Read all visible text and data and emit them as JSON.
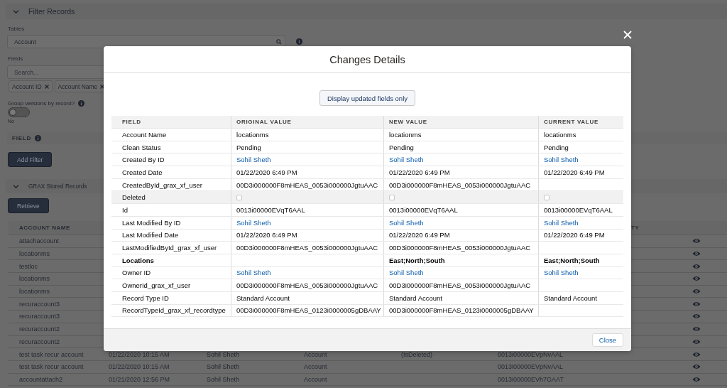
{
  "background": {
    "filter_section": {
      "title": "Filter Records",
      "expanded": true
    },
    "tables": {
      "label": "Tables",
      "value": "Account"
    },
    "fields": {
      "label": "Fields",
      "placeholder": "Search...",
      "pills": [
        "Account ID",
        "Account Name"
      ]
    },
    "group_versions": {
      "label": "Group versions by record?",
      "on": false,
      "state_label": "No"
    },
    "filter_header": "FIELD",
    "add_filter_button": "Add Filter",
    "records_section": {
      "title": "GRAX Stored Records",
      "expanded": true
    },
    "retrieve_button": "Retrieve",
    "records_table": {
      "columns": {
        "account_name": "ACCOUNT NAME",
        "column_7": "TY"
      },
      "rows": [
        {
          "account_name": "attachaccount"
        },
        {
          "account_name": "locationms"
        },
        {
          "account_name": "testloc"
        },
        {
          "account_name": "locationms"
        },
        {
          "account_name": "locationms"
        },
        {
          "account_name": "recuraccount3"
        },
        {
          "account_name": "recuraccount3"
        },
        {
          "account_name": "recuraccount2"
        },
        {
          "account_name": "recuraccount2"
        },
        {
          "account_name": "test task recur account",
          "column_2": "01/22/2020 10:15 AM",
          "column_3": "Sohil Sheth",
          "column_4": "Account",
          "column_5": "(IsDeleted)",
          "column_6": "0013i00000EVpNvAAL"
        },
        {
          "account_name": "test task recur account",
          "column_2": "01/22/2020 10:15 AM",
          "column_3": "Sohil Sheth",
          "column_4": "Account",
          "column_6": "0013i00000EVpNvAAL"
        },
        {
          "account_name": "accountattach2",
          "column_2": "01/21/2020 12:56 PM",
          "column_3": "Sohil Sheth",
          "column_4": "Account",
          "column_6": "0013i00000EVh7GAAT"
        }
      ]
    }
  },
  "modal": {
    "title": "Changes Details",
    "filter_button": "Display updated fields only",
    "columns": [
      "FIELD",
      "ORIGINAL VALUE",
      "NEW VALUE",
      "CURRENT VALUE"
    ],
    "rows": [
      {
        "field": "Account Name",
        "kind": "text",
        "highlighted": false,
        "original": "locationms",
        "new": "locationms",
        "current": "locationms"
      },
      {
        "field": "Clean Status",
        "kind": "text",
        "highlighted": false,
        "original": "Pending",
        "new": "Pending",
        "current": "Pending"
      },
      {
        "field": "Created By ID",
        "kind": "link",
        "highlighted": false,
        "original": "Sohil Sheth",
        "new": "Sohil Sheth",
        "current": "Sohil Sheth"
      },
      {
        "field": "Created Date",
        "kind": "text",
        "highlighted": false,
        "original": "01/22/2020 6:49 PM",
        "new": "01/22/2020 6:49 PM",
        "current": "01/22/2020 6:49 PM"
      },
      {
        "field": "CreatedById_grax_xf_user",
        "kind": "text",
        "highlighted": false,
        "original": "00D3i000000F8mHEAS_0053i000000JgtuAAC",
        "new": "00D3i000000F8mHEAS_0053i000000JgtuAAC"
      },
      {
        "field": "Deleted",
        "kind": "checkbox",
        "highlighted": true,
        "original_checked": false,
        "new_checked": false,
        "current_checked": false
      },
      {
        "field": "Id",
        "kind": "text",
        "highlighted": false,
        "original": "0013i00000EVqT6AAL",
        "new": "0013i00000EVqT6AAL",
        "current": "0013i00000EVqT6AAL"
      },
      {
        "field": "Last Modified By ID",
        "kind": "link",
        "highlighted": false,
        "original": "Sohil Sheth",
        "new": "Sohil Sheth",
        "current": "Sohil Sheth"
      },
      {
        "field": "Last Modified Date",
        "kind": "text",
        "highlighted": false,
        "original": "01/22/2020 6:49 PM",
        "new": "01/22/2020 6:49 PM",
        "current": "01/22/2020 6:49 PM"
      },
      {
        "field": "LastModifiedById_grax_xf_user",
        "kind": "text",
        "highlighted": false,
        "original": "00D3i000000F8mHEAS_0053i000000JgtuAAC",
        "new": "00D3i000000F8mHEAS_0053i000000JgtuAAC"
      },
      {
        "field": "Locations",
        "kind": "bold",
        "highlighted": false,
        "new": "East;North;South",
        "current": "East;North;South"
      },
      {
        "field": "Owner ID",
        "kind": "link",
        "highlighted": false,
        "original": "Sohil Sheth",
        "new": "Sohil Sheth",
        "current": "Sohil Sheth"
      },
      {
        "field": "OwnerId_grax_xf_user",
        "kind": "text",
        "highlighted": false,
        "original": "00D3i000000F8mHEAS_0053i000000JgtuAAC",
        "new": "00D3i000000F8mHEAS_0053i000000JgtuAAC"
      },
      {
        "field": "Record Type ID",
        "kind": "text",
        "highlighted": false,
        "original": "Standard Account",
        "new": "Standard Account",
        "current": "Standard Account"
      },
      {
        "field": "RecordTypeId_grax_xf_recordtype",
        "kind": "text",
        "highlighted": false,
        "original": "00D3i000000F8mHEAS_0123i0000005gDBAAY",
        "new": "00D3i000000F8mHEAS_0123i0000005gDBAAY"
      }
    ],
    "close_button": "Close"
  }
}
